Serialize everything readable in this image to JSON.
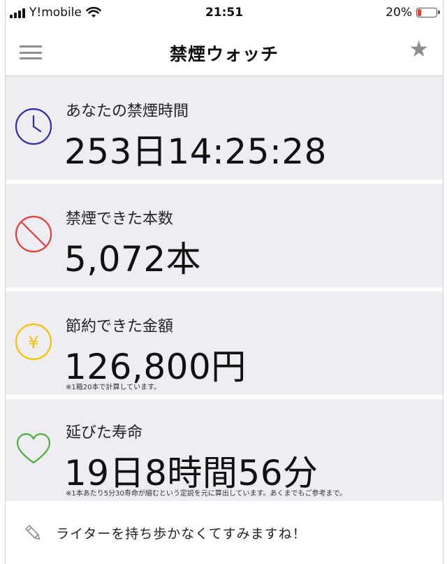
{
  "status_bar": {
    "carrier": "Y!mobile",
    "time": "21:51",
    "battery_percent": "20%",
    "battery_level": 0.2
  },
  "nav": {
    "title": "禁煙ウォッチ",
    "menu_icon": "hamburger-menu-icon",
    "favorite_icon": "star-icon"
  },
  "cards": [
    {
      "icon": "clock-icon",
      "icon_color": "#2f2aa8",
      "label": "あなたの禁煙時間",
      "value": "253日14:25:28",
      "note": ""
    },
    {
      "icon": "prohibited-icon",
      "icon_color": "#e53b3b",
      "label": "禁煙できた本数",
      "value": "5,072本",
      "note": ""
    },
    {
      "icon": "yen-icon",
      "icon_color": "#f2c200",
      "label": "節約できた金額",
      "value": "126,800円",
      "note": "※1箱20本で計算しています。"
    },
    {
      "icon": "heart-icon",
      "icon_color": "#4caf3b",
      "label": "延びた寿命",
      "value": "19日8時間56分",
      "note": "※1本あたり5分30寿命が縮むという定説を元に算出しています。あくまでもご参考まで。"
    }
  ],
  "footer": {
    "icon": "pencil-icon",
    "message": "ライターを持ち歩かなくてすみますね！"
  }
}
